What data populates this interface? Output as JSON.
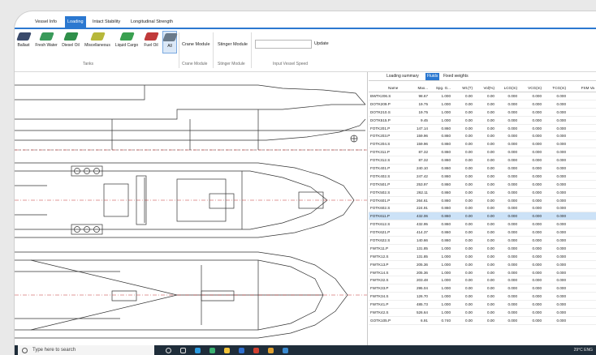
{
  "tabs": [
    "Vessel Info",
    "Loading",
    "Intact Stability",
    "Longitudinal Strength"
  ],
  "active_tab": "Loading",
  "ribbon": {
    "tank_buttons": [
      {
        "label": "Ballast",
        "icon": "ballast-tank-icon",
        "color": "#3a4a6b"
      },
      {
        "label": "Fresh Water",
        "icon": "fresh-water-tank-icon",
        "color": "#3a9a5a"
      },
      {
        "label": "Diesel Oil",
        "icon": "diesel-oil-tank-icon",
        "color": "#2f8f4a"
      },
      {
        "label": "Miscellaneous",
        "icon": "miscellaneous-tank-icon",
        "color": "#b7b83a"
      },
      {
        "label": "Liquid Cargo",
        "icon": "liquid-cargo-tank-icon",
        "color": "#3aa050"
      },
      {
        "label": "Fuel Oil",
        "icon": "fuel-oil-tank-icon",
        "color": "#c03a3a"
      },
      {
        "label": "All",
        "icon": "all-tanks-icon",
        "color": "#6a7a8a"
      }
    ],
    "tanks_group_label": "Tanks",
    "crane_module_label": "Crane Module",
    "crane_group_label": "Crane Module",
    "stinger_module_label": "Stinger Module",
    "stinger_group_label": "Stinger Module",
    "speed_placeholder": "",
    "update_label": "Update",
    "speed_group_label": "Input Vessel Speed"
  },
  "panel": {
    "subtabs": [
      "Loading summary",
      "Fluids",
      "Fixed weights"
    ],
    "active_subtab": "Fluids",
    "columns": [
      "Name",
      "Max...",
      "Spg. G...",
      "Wt.(T)",
      "Vol(%)",
      "LCG(m)",
      "VCG(m)",
      "TCG(m)",
      "FSM Va"
    ],
    "rows": [
      [
        "BWTK206.S",
        "98.67",
        "1.000",
        "0.00",
        "0.00",
        "0.000",
        "0.000",
        "0.000",
        ""
      ],
      [
        "DOTK209.P",
        "19.75",
        "1.000",
        "0.00",
        "0.00",
        "0.000",
        "0.000",
        "0.000",
        ""
      ],
      [
        "DOTK210.S",
        "19.75",
        "1.000",
        "0.00",
        "0.00",
        "0.000",
        "0.000",
        "0.000",
        ""
      ],
      [
        "DOTK515.P",
        "9.45",
        "1.000",
        "0.00",
        "0.00",
        "0.000",
        "0.000",
        "0.000",
        ""
      ],
      [
        "FOTK201.P",
        "147.14",
        "0.860",
        "0.00",
        "0.00",
        "0.000",
        "0.000",
        "0.000",
        ""
      ],
      [
        "FOTK203.P",
        "159.96",
        "0.860",
        "0.00",
        "0.00",
        "0.000",
        "0.000",
        "0.000",
        ""
      ],
      [
        "FOTK204.S",
        "159.96",
        "0.860",
        "0.00",
        "0.00",
        "0.000",
        "0.000",
        "0.000",
        ""
      ],
      [
        "FOTK311.P",
        "87.32",
        "0.860",
        "0.00",
        "0.00",
        "0.000",
        "0.000",
        "0.000",
        ""
      ],
      [
        "FOTK312.S",
        "87.32",
        "0.860",
        "0.00",
        "0.00",
        "0.000",
        "0.000",
        "0.000",
        ""
      ],
      [
        "FOTK401.P",
        "240.10",
        "0.860",
        "0.00",
        "0.00",
        "0.000",
        "0.000",
        "0.000",
        ""
      ],
      [
        "FOTK402.S",
        "247.42",
        "0.860",
        "0.00",
        "0.00",
        "0.000",
        "0.000",
        "0.000",
        ""
      ],
      [
        "FOTK501.P",
        "253.97",
        "0.860",
        "0.00",
        "0.00",
        "0.000",
        "0.000",
        "0.000",
        ""
      ],
      [
        "FOTK502.S",
        "262.11",
        "0.860",
        "0.00",
        "0.00",
        "0.000",
        "0.000",
        "0.000",
        ""
      ],
      [
        "FOTK601.P",
        "264.61",
        "0.860",
        "0.00",
        "0.00",
        "0.000",
        "0.000",
        "0.000",
        ""
      ],
      [
        "FOTK602.S",
        "224.91",
        "0.860",
        "0.00",
        "0.00",
        "0.000",
        "0.000",
        "0.000",
        ""
      ],
      [
        "FOTK611.P",
        "432.06",
        "0.860",
        "0.00",
        "0.00",
        "0.000",
        "0.000",
        "0.000",
        ""
      ],
      [
        "FOTK612.S",
        "432.95",
        "0.860",
        "0.00",
        "0.00",
        "0.000",
        "0.000",
        "0.000",
        ""
      ],
      [
        "FOTK621.P",
        "414.37",
        "0.860",
        "0.00",
        "0.00",
        "0.000",
        "0.000",
        "0.000",
        ""
      ],
      [
        "FOTK622.S",
        "140.66",
        "0.860",
        "0.00",
        "0.00",
        "0.000",
        "0.000",
        "0.000",
        ""
      ],
      [
        "FWTK11.P",
        "131.85",
        "1.000",
        "0.00",
        "0.00",
        "0.000",
        "0.000",
        "0.000",
        ""
      ],
      [
        "FWTK12.S",
        "131.85",
        "1.000",
        "0.00",
        "0.00",
        "0.000",
        "0.000",
        "0.000",
        ""
      ],
      [
        "FWTK13.P",
        "205.36",
        "1.000",
        "0.00",
        "0.00",
        "0.000",
        "0.000",
        "0.000",
        ""
      ],
      [
        "FWTK14.S",
        "205.36",
        "1.000",
        "0.00",
        "0.00",
        "0.000",
        "0.000",
        "0.000",
        ""
      ],
      [
        "FWTK32.S",
        "203.48",
        "1.000",
        "0.00",
        "0.00",
        "0.000",
        "0.000",
        "0.000",
        ""
      ],
      [
        "FWTK33.P",
        "295.04",
        "1.000",
        "0.00",
        "0.00",
        "0.000",
        "0.000",
        "0.000",
        ""
      ],
      [
        "FWTK34.S",
        "126.70",
        "1.000",
        "0.00",
        "0.00",
        "0.000",
        "0.000",
        "0.000",
        ""
      ],
      [
        "FWTK41.P",
        "485.73",
        "1.000",
        "0.00",
        "0.00",
        "0.000",
        "0.000",
        "0.000",
        ""
      ],
      [
        "FWTK42.S",
        "526.64",
        "1.000",
        "0.00",
        "0.00",
        "0.000",
        "0.000",
        "0.000",
        ""
      ],
      [
        "GOTK105.P",
        "6.91",
        "0.740",
        "0.00",
        "0.00",
        "0.000",
        "0.000",
        "0.000",
        ""
      ]
    ],
    "selected_row": "FOTK611.P"
  },
  "taskbar": {
    "search_text": "Type here to search",
    "tray_text": "29°C   ENG"
  },
  "colors": {
    "accent": "#2b78d0",
    "selected_row": "#cce2f7",
    "taskbar": "#1f2d3a",
    "centerline": "#c03030"
  }
}
